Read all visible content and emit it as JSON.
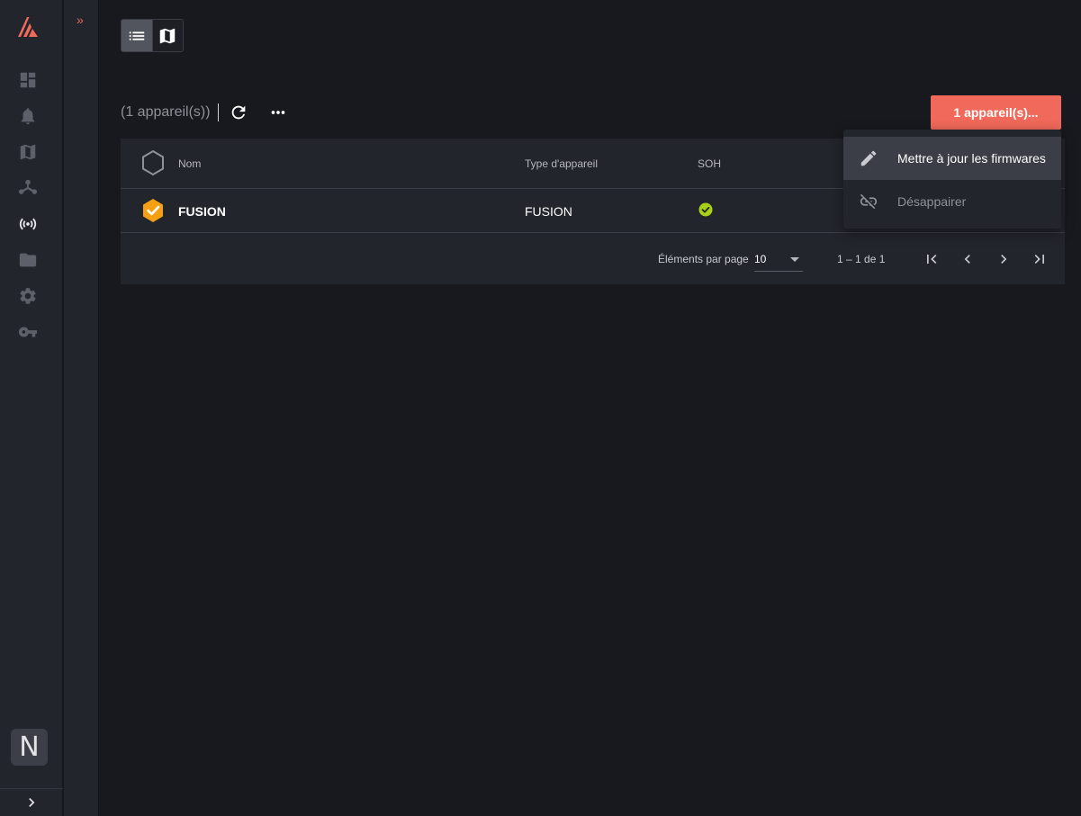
{
  "sidebar": {
    "items": [
      {
        "name": "dashboard-icon"
      },
      {
        "name": "bell-icon"
      },
      {
        "name": "map-icon"
      },
      {
        "name": "network-icon"
      },
      {
        "name": "broadcast-icon",
        "active": true
      },
      {
        "name": "folder-icon"
      },
      {
        "name": "gear-icon"
      },
      {
        "name": "key-icon"
      }
    ],
    "avatar_letter": "N",
    "collapse_icon": "chevron-right-icon"
  },
  "subsidebar": {
    "expand_label": "»"
  },
  "toolbar": {
    "device_count": "(1 appareil(s))",
    "action_button": "1 appareil(s)..."
  },
  "table": {
    "columns": [
      "Nom",
      "Type d'appareil",
      "SOH"
    ],
    "rows": [
      {
        "name": "FUSION",
        "type": "FUSION",
        "soh": "ok"
      }
    ]
  },
  "paginator": {
    "items_per_page_label": "Éléments par page",
    "items_per_page_value": "10",
    "range": "1 – 1 de 1"
  },
  "menu": {
    "items": [
      {
        "label": "Mettre à jour les firmwares",
        "icon": "pencil-icon"
      },
      {
        "label": "Désappairer",
        "icon": "link-off-icon"
      }
    ]
  },
  "colors": {
    "accent": "#f0695a",
    "device_badge": "#f5a012",
    "soh_ok": "#a8d11a",
    "background": "#17191e",
    "panel": "#23252d"
  }
}
